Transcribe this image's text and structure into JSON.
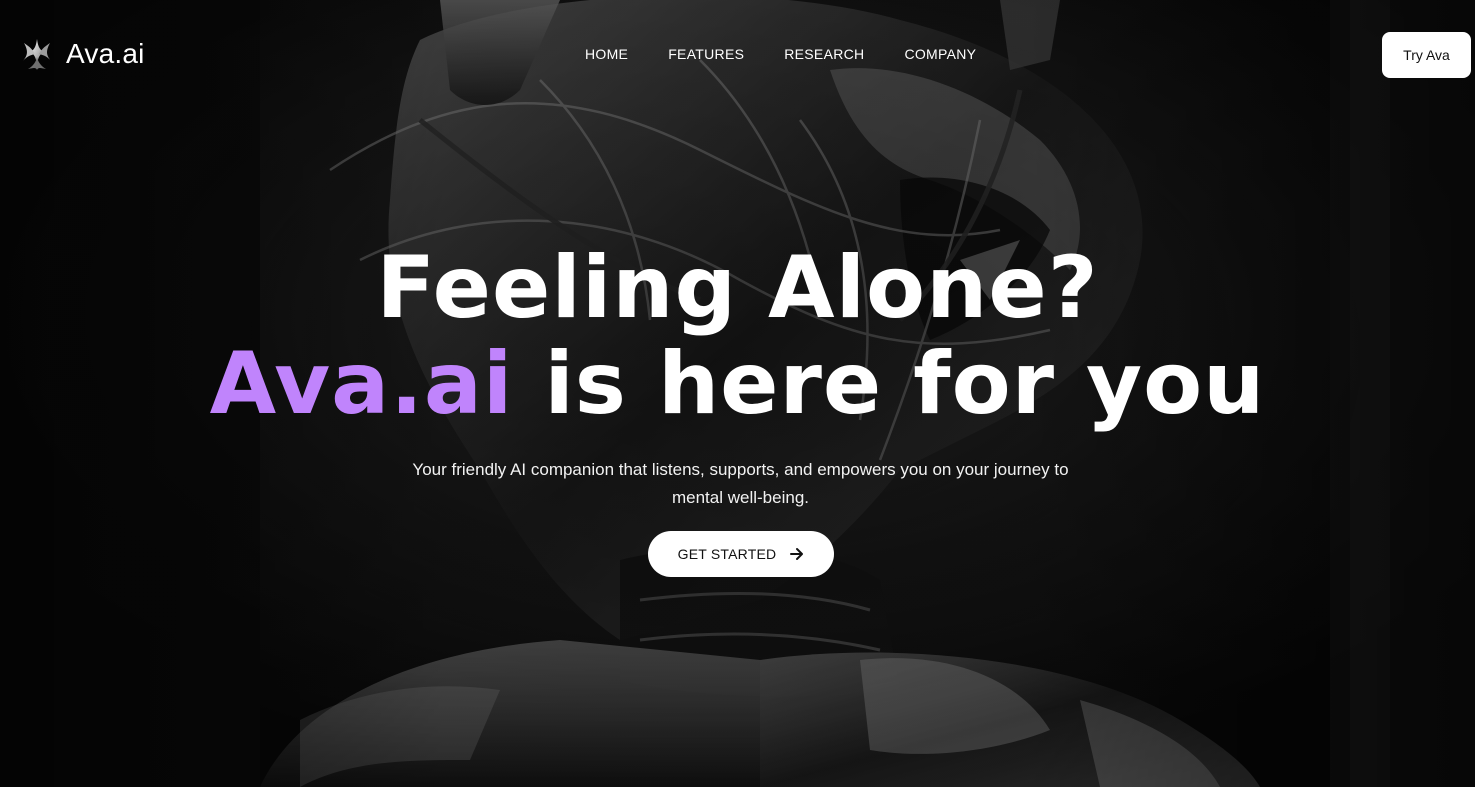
{
  "brand": {
    "name": "Ava.ai",
    "logo_icon": "sparkle-star-icon"
  },
  "nav": {
    "items": [
      {
        "label": "HOME"
      },
      {
        "label": "FEATURES"
      },
      {
        "label": "RESEARCH"
      },
      {
        "label": "COMPANY"
      }
    ],
    "cta_label": "Try Ava"
  },
  "hero": {
    "title_line1": "Feeling Alone?",
    "title_accent": "Ava.ai",
    "title_line2_rest": " is here for you",
    "subtitle": "Your friendly AI companion that listens, supports, and empowers you on your journey to mental well-being.",
    "cta_label": "GET STARTED",
    "cta_icon": "arrow-right-icon"
  },
  "colors": {
    "accent": "#c084fc",
    "background": "#060606",
    "text": "#ffffff",
    "button_bg": "#ffffff",
    "button_text": "#111111"
  }
}
